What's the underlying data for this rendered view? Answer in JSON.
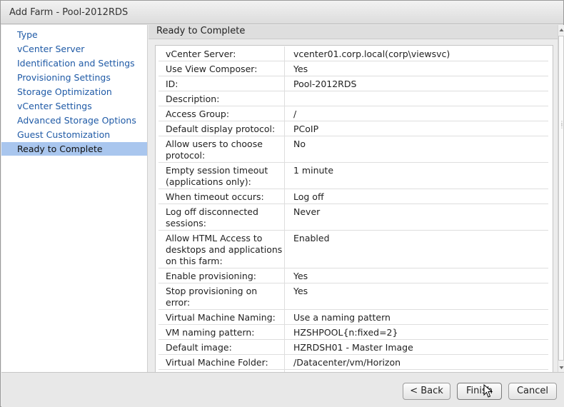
{
  "window": {
    "title": "Add Farm - Pool-2012RDS"
  },
  "sidebar": {
    "items": [
      {
        "label": "Type"
      },
      {
        "label": "vCenter Server"
      },
      {
        "label": "Identification and Settings"
      },
      {
        "label": "Provisioning Settings"
      },
      {
        "label": "Storage Optimization"
      },
      {
        "label": "vCenter Settings"
      },
      {
        "label": "Advanced Storage Options"
      },
      {
        "label": "Guest Customization"
      },
      {
        "label": "Ready to Complete",
        "active": true
      }
    ]
  },
  "main": {
    "section_title": "Ready to Complete",
    "rows": [
      {
        "label": "vCenter Server:",
        "value": "vcenter01.corp.local(corp\\viewsvc)"
      },
      {
        "label": "Use View Composer:",
        "value": "Yes"
      },
      {
        "label": "ID:",
        "value": "Pool-2012RDS"
      },
      {
        "label": "Description:",
        "value": ""
      },
      {
        "label": "Access Group:",
        "value": "/"
      },
      {
        "label": "Default display protocol:",
        "value": "PCoIP"
      },
      {
        "label": "Allow users to choose protocol:",
        "value": "No"
      },
      {
        "label": "Empty session timeout (applications only):",
        "value": "1 minute"
      },
      {
        "label": "When timeout occurs:",
        "value": "Log off"
      },
      {
        "label": "Log off disconnected sessions:",
        "value": "Never"
      },
      {
        "label": "Allow HTML Access to desktops and applications on this farm:",
        "value": "Enabled"
      },
      {
        "label": "Enable provisioning:",
        "value": "Yes"
      },
      {
        "label": "Stop provisioning on error:",
        "value": "Yes"
      },
      {
        "label": "Virtual Machine Naming:",
        "value": "Use a naming pattern"
      },
      {
        "label": "VM naming pattern:",
        "value": "HZSHPOOL{n:fixed=2}"
      },
      {
        "label": "Default image:",
        "value": "HZRDSH01 - Master Image"
      },
      {
        "label": "Virtual Machine Folder:",
        "value": "/Datacenter/vm/Horizon"
      },
      {
        "label": "",
        "value": ""
      }
    ]
  },
  "footer": {
    "back_label": "< Back",
    "finish_label": "Finish",
    "cancel_label": "Cancel"
  },
  "colors": {
    "nav_link": "#1f5aa6",
    "nav_active_bg": "#a9c6ee",
    "section_head_bg": "#dedede"
  },
  "icons": {
    "scroll_up": "triangle-up",
    "scroll_down": "triangle-down",
    "cursor": "mouse-pointer"
  }
}
